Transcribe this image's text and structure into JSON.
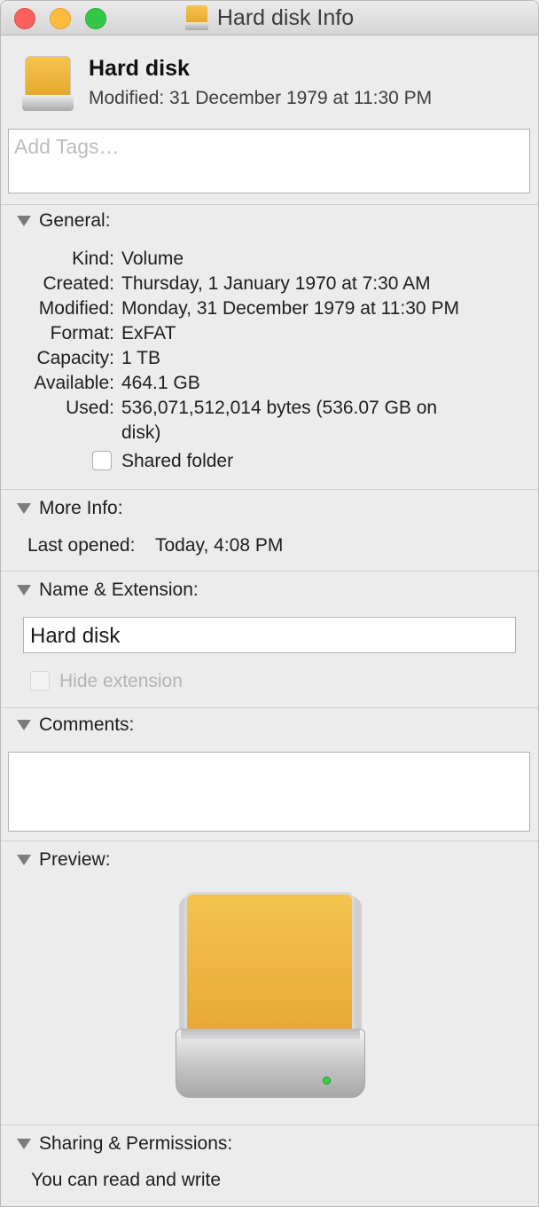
{
  "window": {
    "title": "Hard disk Info"
  },
  "header": {
    "name": "Hard disk",
    "modified": "Modified: 31 December 1979 at 11:30 PM"
  },
  "tags": {
    "placeholder": "Add Tags…"
  },
  "general": {
    "title": "General:",
    "rows": [
      {
        "label": "Kind:",
        "value": "Volume"
      },
      {
        "label": "Created:",
        "value": "Thursday, 1 January 1970 at 7:30 AM"
      },
      {
        "label": "Modified:",
        "value": "Monday, 31 December 1979 at 11:30 PM"
      },
      {
        "label": "Format:",
        "value": "ExFAT"
      },
      {
        "label": "Capacity:",
        "value": "1 TB"
      },
      {
        "label": "Available:",
        "value": "464.1 GB"
      },
      {
        "label": "Used:",
        "value": "536,071,512,014 bytes (536.07 GB on",
        "value_line2": "disk)"
      }
    ],
    "shared_folder_label": "Shared folder",
    "shared_folder_checked": false
  },
  "more_info": {
    "title": "More Info:",
    "last_opened_label": "Last opened:",
    "last_opened_value": "Today, 4:08 PM"
  },
  "name_extension": {
    "title": "Name & Extension:",
    "name_value": "Hard disk",
    "hide_extension_label": "Hide extension",
    "hide_extension_checked": false,
    "hide_extension_enabled": false
  },
  "comments": {
    "title": "Comments:",
    "value": ""
  },
  "preview": {
    "title": "Preview:",
    "icon": "external-hard-drive-icon"
  },
  "sharing": {
    "title": "Sharing & Permissions:",
    "text": "You can read and write"
  },
  "colors": {
    "close": "#fc605c",
    "minimize": "#fdbc40",
    "maximize": "#34c84a",
    "drive_orange": "#f3c44e"
  }
}
